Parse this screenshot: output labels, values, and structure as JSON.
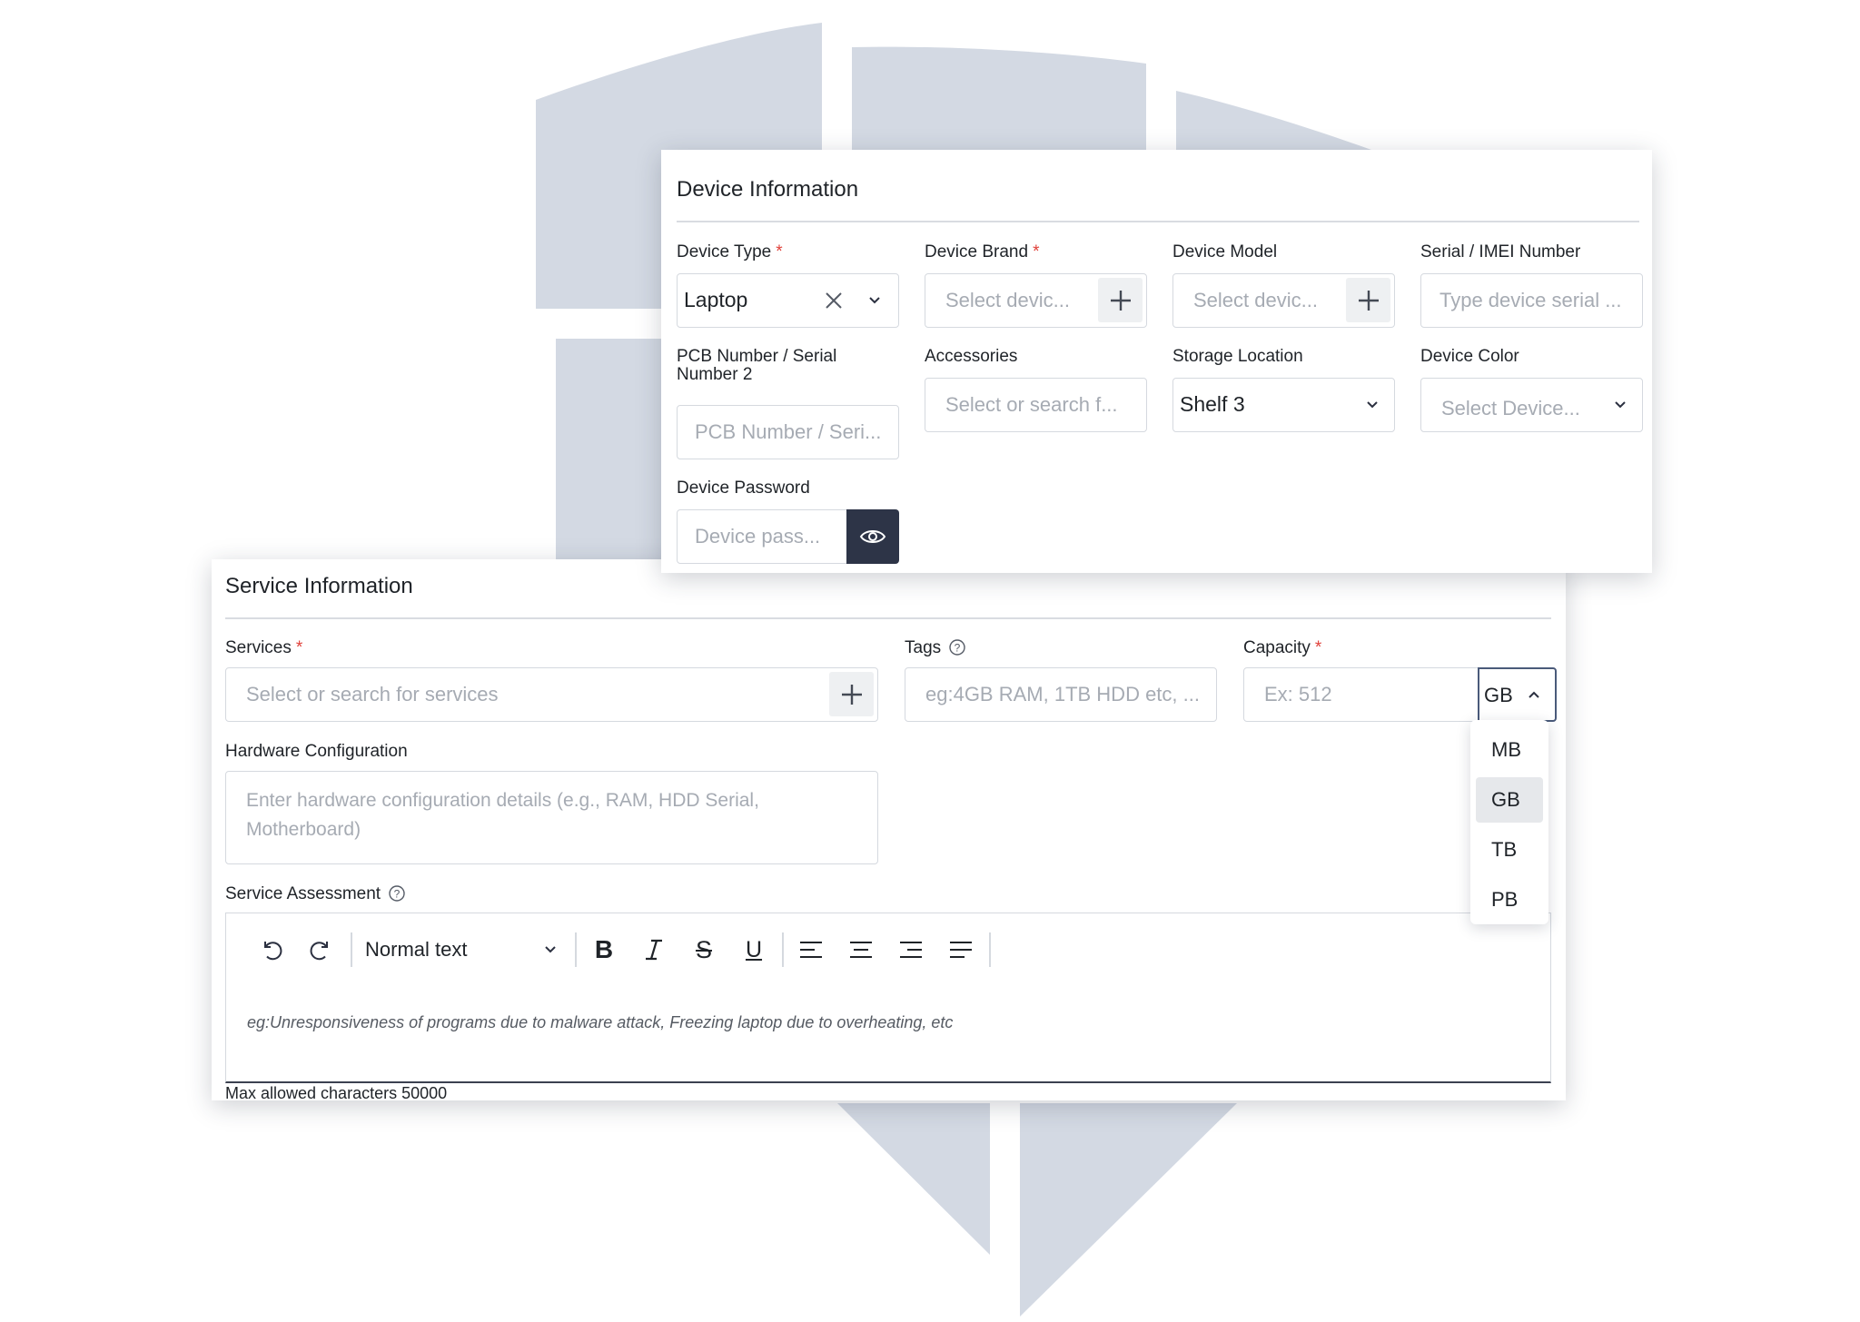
{
  "colors": {
    "shield": "#d3d9e3",
    "required": "#e0413a",
    "dark_button": "#2d3447"
  },
  "device_info": {
    "title": "Device Information",
    "device_type": {
      "label": "Device Type",
      "value": "Laptop"
    },
    "device_brand": {
      "label": "Device Brand",
      "placeholder": "Select devic..."
    },
    "device_model": {
      "label": "Device Model",
      "placeholder": "Select devic..."
    },
    "serial": {
      "label": "Serial / IMEI Number",
      "placeholder": "Type device serial ..."
    },
    "pcb": {
      "label_line1": "PCB Number / Serial",
      "label_line2": "Number 2",
      "placeholder": "PCB Number / Seri..."
    },
    "accessories": {
      "label": "Accessories",
      "placeholder": "Select or search f..."
    },
    "storage_location": {
      "label": "Storage Location",
      "value": "Shelf 3"
    },
    "device_color": {
      "label": "Device Color",
      "placeholder": "Select Device..."
    },
    "password": {
      "label": "Device Password",
      "placeholder": "Device pass..."
    }
  },
  "service_info": {
    "title": "Service Information",
    "services": {
      "label": "Services",
      "placeholder": "Select or search for services"
    },
    "tags": {
      "label": "Tags",
      "placeholder": "eg:4GB RAM, 1TB HDD etc, ..."
    },
    "capacity": {
      "label": "Capacity",
      "placeholder": "Ex: 512",
      "unit": "GB",
      "unit_options": [
        "MB",
        "GB",
        "TB",
        "PB"
      ],
      "selected_unit": "GB"
    },
    "hardware": {
      "label": "Hardware Configuration",
      "placeholder_line1": "Enter hardware configuration details (e.g., RAM, HDD Serial,",
      "placeholder_line2": "Motherboard)"
    },
    "assessment": {
      "label": "Service Assessment",
      "text_style": "Normal text",
      "placeholder": "eg:Unresponsiveness of programs due to malware attack, Freezing laptop due to overheating, etc",
      "max_chars": "Max allowed characters 50000"
    }
  }
}
